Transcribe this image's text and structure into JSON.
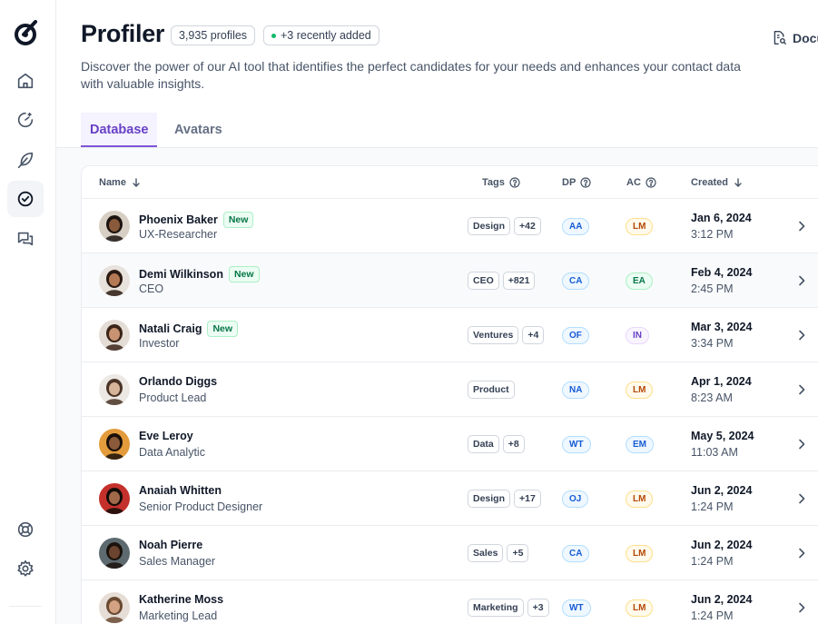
{
  "header": {
    "title": "Profiler",
    "profile_count": "3,935 profiles",
    "recent": "+3 recently added",
    "docs_label": "Docu",
    "description": "Discover the power of our AI tool that identifies the perfect candidates for your needs and enhances your contact data with valuable insights."
  },
  "tabs": [
    {
      "label": "Database",
      "active": true
    },
    {
      "label": "Avatars",
      "active": false
    }
  ],
  "table": {
    "columns": {
      "name": "Name",
      "tags": "Tags",
      "dp": "DP",
      "ac": "AC",
      "created": "Created"
    },
    "rows": [
      {
        "name": "Phoenix Baker",
        "new": "New",
        "role": "UX-Researcher",
        "tags": [
          "Design",
          "+42"
        ],
        "dp": "AA",
        "dp_color": "blue",
        "ac": "LM",
        "ac_color": "orange",
        "date": "Jan 6, 2024",
        "time": "3:12 PM",
        "avatar_skin": "#8a5a3c",
        "avatar_hair": "#1c1410",
        "avatar_bg": "#d8cfc4"
      },
      {
        "name": "Demi Wilkinson",
        "new": "New",
        "role": "CEO",
        "tags": [
          "CEO",
          "+821"
        ],
        "dp": "CA",
        "dp_color": "blue",
        "ac": "EA",
        "ac_color": "green",
        "date": "Feb 4, 2024",
        "time": "2:45 PM",
        "avatar_skin": "#b47a55",
        "avatar_hair": "#2a1a12",
        "avatar_bg": "#e8e2dc"
      },
      {
        "name": "Natali Craig",
        "new": "New",
        "role": "Investor",
        "tags": [
          "Ventures",
          "+4"
        ],
        "dp": "OF",
        "dp_color": "blue",
        "ac": "IN",
        "ac_color": "purple",
        "date": "Mar 3, 2024",
        "time": "3:34 PM",
        "avatar_skin": "#c79373",
        "avatar_hair": "#3b2418",
        "avatar_bg": "#e4ddd6"
      },
      {
        "name": "Orlando Diggs",
        "new": "",
        "role": "Product Lead",
        "tags": [
          "Product"
        ],
        "dp": "NA",
        "dp_color": "blue",
        "ac": "LM",
        "ac_color": "orange",
        "date": "Apr 1, 2024",
        "time": "8:23 AM",
        "avatar_skin": "#d6b49a",
        "avatar_hair": "#4a3426",
        "avatar_bg": "#ece8e4"
      },
      {
        "name": "Eve Leroy",
        "new": "",
        "role": "Data Analytic",
        "tags": [
          "Data",
          "+8"
        ],
        "dp": "WT",
        "dp_color": "blue",
        "ac": "EM",
        "ac_color": "blue",
        "date": "May 5, 2024",
        "time": "11:03 AM",
        "avatar_skin": "#8b5a3a",
        "avatar_hair": "#1a100a",
        "avatar_bg": "#e39b3b"
      },
      {
        "name": "Anaiah Whitten",
        "new": "",
        "role": "Senior Product Designer",
        "tags": [
          "Design",
          "+17"
        ],
        "dp": "OJ",
        "dp_color": "blue",
        "ac": "LM",
        "ac_color": "orange",
        "date": "Jun 2, 2024",
        "time": "1:24 PM",
        "avatar_skin": "#a0694a",
        "avatar_hair": "#120c08",
        "avatar_bg": "#c4302b"
      },
      {
        "name": "Noah Pierre",
        "new": "",
        "role": "Sales Manager",
        "tags": [
          "Sales",
          "+5"
        ],
        "dp": "CA",
        "dp_color": "blue",
        "ac": "LM",
        "ac_color": "orange",
        "date": "Jun 2, 2024",
        "time": "1:24 PM",
        "avatar_skin": "#6b4430",
        "avatar_hair": "#1a120c",
        "avatar_bg": "#5d6a70"
      },
      {
        "name": "Katherine Moss",
        "new": "",
        "role": "Marketing Lead",
        "tags": [
          "Marketing",
          "+3"
        ],
        "dp": "WT",
        "dp_color": "blue",
        "ac": "LM",
        "ac_color": "orange",
        "date": "Jun 2, 2024",
        "time": "1:24 PM",
        "avatar_skin": "#d2a282",
        "avatar_hair": "#6a4a32",
        "avatar_bg": "#e6ded6"
      }
    ]
  },
  "sidebar": {
    "icons": [
      "logo-icon",
      "home-icon",
      "dashboard-icon",
      "feather-icon",
      "check-circle-icon",
      "messages-icon",
      "support-icon",
      "settings-icon"
    ]
  }
}
